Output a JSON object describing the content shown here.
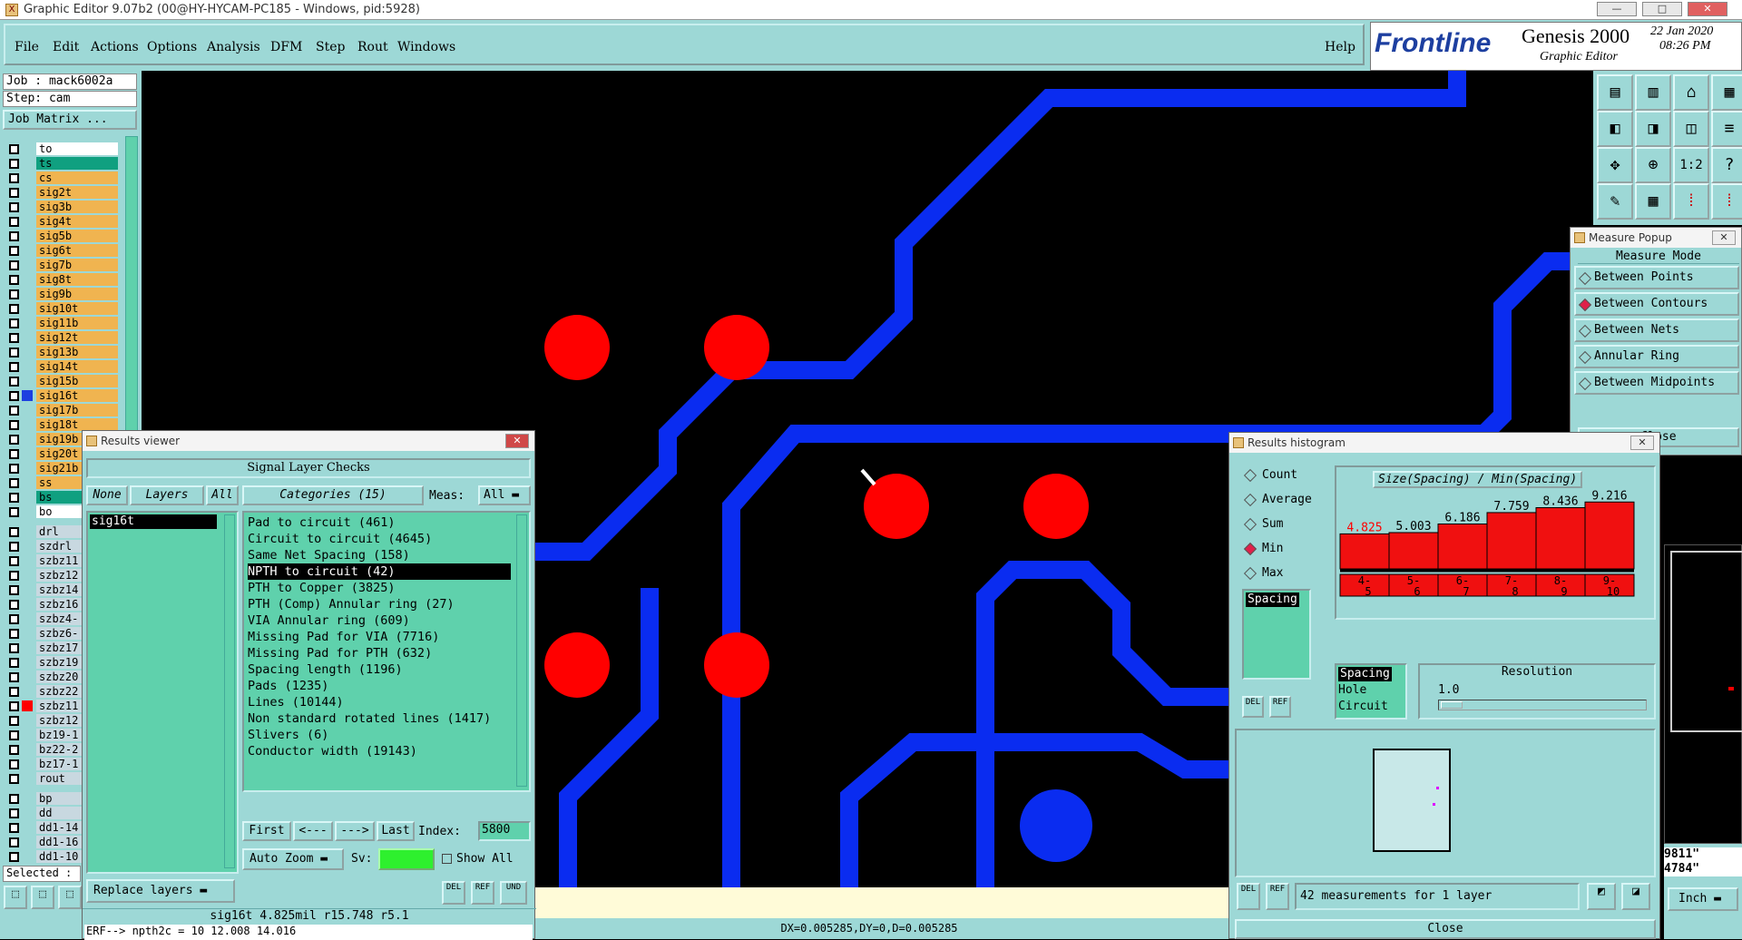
{
  "window": {
    "title": "Graphic Editor 9.07b2 (00@HY-HYCAM-PC185 - Windows, pid:5928)"
  },
  "menu": {
    "items": [
      "File",
      "Edit",
      "Actions",
      "Options",
      "Analysis",
      "DFM",
      "Step",
      "Rout",
      "Windows"
    ],
    "help": "Help"
  },
  "brand": {
    "logo": "Frontline",
    "product": "Genesis 2000",
    "subtitle": "Graphic Editor",
    "date": "22 Jan 2020",
    "time": "08:26 PM"
  },
  "job": {
    "job": "Job : mack6002a",
    "step": "Step: cam",
    "matrix_button": "Job Matrix ..."
  },
  "layers": [
    {
      "name": "to",
      "color": "#ffffff"
    },
    {
      "name": "ts",
      "color": "#10a080"
    },
    {
      "name": "cs",
      "color": "#f0b450"
    },
    {
      "name": "sig2t",
      "color": "#f0b450"
    },
    {
      "name": "sig3b",
      "color": "#f0b450"
    },
    {
      "name": "sig4t",
      "color": "#f0b450"
    },
    {
      "name": "sig5b",
      "color": "#f0b450"
    },
    {
      "name": "sig6t",
      "color": "#f0b450"
    },
    {
      "name": "sig7b",
      "color": "#f0b450"
    },
    {
      "name": "sig8t",
      "color": "#f0b450"
    },
    {
      "name": "sig9b",
      "color": "#f0b450"
    },
    {
      "name": "sig10t",
      "color": "#f0b450"
    },
    {
      "name": "sig11b",
      "color": "#f0b450"
    },
    {
      "name": "sig12t",
      "color": "#f0b450"
    },
    {
      "name": "sig13b",
      "color": "#f0b450"
    },
    {
      "name": "sig14t",
      "color": "#f0b450"
    },
    {
      "name": "sig15b",
      "color": "#f0b450"
    },
    {
      "name": "sig16t",
      "color": "#f0b450"
    },
    {
      "name": "sig17b",
      "color": "#f0b450"
    },
    {
      "name": "sig18t",
      "color": "#f0b450"
    },
    {
      "name": "sig19b",
      "color": "#f0b450"
    },
    {
      "name": "sig20t",
      "color": "#f0b450"
    },
    {
      "name": "sig21b",
      "color": "#f0b450"
    },
    {
      "name": "ss",
      "color": "#f0b450"
    },
    {
      "name": "bs",
      "color": "#10a080"
    },
    {
      "name": "bo",
      "color": "#ffffff"
    },
    {
      "name": "drl",
      "color": "#c8d8e0"
    },
    {
      "name": "szdrl",
      "color": "#c8d8e0"
    },
    {
      "name": "szbz11",
      "color": "#c8d8e0"
    },
    {
      "name": "szbz12",
      "color": "#c8d8e0"
    },
    {
      "name": "szbz14",
      "color": "#c8d8e0"
    },
    {
      "name": "szbz16",
      "color": "#c8d8e0"
    },
    {
      "name": "szbz4-",
      "color": "#c8d8e0"
    },
    {
      "name": "szbz6-",
      "color": "#c8d8e0"
    },
    {
      "name": "szbz17",
      "color": "#c8d8e0"
    },
    {
      "name": "szbz19",
      "color": "#c8d8e0"
    },
    {
      "name": "szbz20",
      "color": "#c8d8e0"
    },
    {
      "name": "szbz22",
      "color": "#c8d8e0"
    },
    {
      "name": "szbz11",
      "color": "#c8d8e0"
    },
    {
      "name": "szbz12",
      "color": "#c8d8e0"
    },
    {
      "name": "bz19-1",
      "color": "#c8d8e0"
    },
    {
      "name": "bz22-2",
      "color": "#c8d8e0"
    },
    {
      "name": "bz17-1",
      "color": "#c8d8e0"
    },
    {
      "name": "rout",
      "color": "#c8d8e0"
    },
    {
      "name": "bp",
      "color": "#c8d8e0"
    },
    {
      "name": "dd",
      "color": "#c8d8e0"
    },
    {
      "name": "dd1-14",
      "color": "#c8d8e0"
    },
    {
      "name": "dd1-16",
      "color": "#c8d8e0"
    },
    {
      "name": "dd1-10",
      "color": "#c8d8e0"
    }
  ],
  "selected_label": "Selected :",
  "results_viewer": {
    "title": "Results viewer",
    "header": "Signal Layer Checks",
    "none": "None",
    "layers": "Layers",
    "all": "All",
    "categories": "Categories (15)",
    "meas": "Meas:",
    "meas_value": "All",
    "layer_selected": "sig16t",
    "items": [
      "Pad to circuit (461)",
      "Circuit to circuit (4645)",
      "Same Net Spacing (158)",
      "NPTH to circuit (42)",
      "PTH to Copper (3825)",
      "PTH (Comp) Annular ring (27)",
      "VIA Annular ring (609)",
      "Missing Pad for VIA (7716)",
      "Missing Pad for PTH (632)",
      "Spacing length (1196)",
      "Pads (1235)",
      "Lines (10144)",
      "Non standard rotated lines (1417)",
      "Slivers (6)",
      "Conductor width (19143)"
    ],
    "first": "First",
    "prev": "<---",
    "next": "--->",
    "last": "Last",
    "index_label": "Index:",
    "index_value": "5800",
    "auto_zoom": "Auto Zoom",
    "sv": "Sv:",
    "show_all": "Show All",
    "replace": "Replace layers",
    "status": "sig16t 4.825mil  r15.748  r5.1",
    "err": "ERF--> npth2c = 10 12.008 14.016"
  },
  "measure": {
    "title": "Measure Popup",
    "header": "Measure Mode",
    "items": [
      "Between Points",
      "Between Contours",
      "Between Nets",
      "Annular Ring",
      "Between Midpoints"
    ],
    "close": "Close"
  },
  "histogram": {
    "title": "Results histogram",
    "chart_title": "Size(Spacing) / Min(Spacing)",
    "modes": [
      "Count",
      "Average",
      "Sum",
      "Min",
      "Max"
    ],
    "list1": [
      "Spacing"
    ],
    "list2": [
      "Spacing",
      "Hole",
      "Circuit"
    ],
    "resolution_label": "Resolution",
    "resolution_value": "1.0",
    "footer": "42 measurements for 1 layer",
    "close": "Close",
    "del": "DEL",
    "ref": "REF"
  },
  "chart_data": {
    "type": "bar",
    "title": "Size(Spacing) / Min(Spacing)",
    "categories": [
      "4-5",
      "5-6",
      "6-7",
      "7-8",
      "8-9",
      "9-10"
    ],
    "values": [
      4.825,
      5.003,
      6.186,
      7.759,
      8.436,
      9.216
    ]
  },
  "status_bar": {
    "coords": "DX=0.005285,DY=0,D=0.005285",
    "right1": "9811\"",
    "right2": "4784\"",
    "units": "Inch"
  }
}
